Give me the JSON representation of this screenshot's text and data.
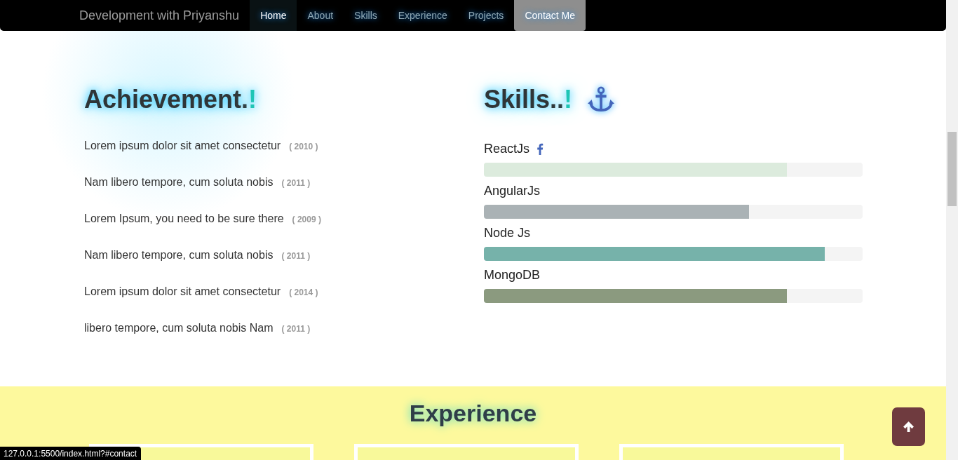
{
  "navbar": {
    "brand": "Development with Priyanshu",
    "links": [
      {
        "label": "Home",
        "selected": true,
        "highlighted": false
      },
      {
        "label": "About",
        "selected": false,
        "highlighted": false
      },
      {
        "label": "Skills",
        "selected": false,
        "highlighted": false
      },
      {
        "label": "Experience",
        "selected": false,
        "highlighted": false
      },
      {
        "label": "Projects",
        "selected": false,
        "highlighted": false
      },
      {
        "label": "Contact Me",
        "selected": false,
        "highlighted": true
      }
    ]
  },
  "achievement": {
    "title": "Achievement.",
    "title_mark": "!",
    "items": [
      {
        "text": "Lorem ipsum dolor sit amet consectetur",
        "year": "( 2010 )"
      },
      {
        "text": "Nam libero tempore, cum soluta nobis",
        "year": "( 2011 )"
      },
      {
        "text": "Lorem Ipsum, you need to be sure there",
        "year": "( 2009 )"
      },
      {
        "text": "Nam libero tempore, cum soluta nobis",
        "year": "( 2011 )"
      },
      {
        "text": "Lorem ipsum dolor sit amet consectetur",
        "year": "( 2014 )"
      },
      {
        "text": "libero tempore, cum soluta nobis Nam",
        "year": "( 2011 )"
      }
    ]
  },
  "skills": {
    "title": "Skills..",
    "title_mark": "!",
    "items": [
      {
        "name": "ReactJs",
        "icon": true,
        "level": 0.8,
        "color": "#dcebdd"
      },
      {
        "name": "AngularJs",
        "icon": false,
        "level": 0.7,
        "color": "#aab2b5"
      },
      {
        "name": "Node Js",
        "icon": false,
        "level": 0.9,
        "color": "#76b2aa"
      },
      {
        "name": "MongoDB",
        "icon": false,
        "level": 0.8,
        "color": "#8b9a7f"
      }
    ]
  },
  "experience": {
    "title": "Experience",
    "cards": [
      {
        "kind": "card"
      },
      {
        "kind": "card"
      },
      {
        "kind": "card"
      }
    ]
  },
  "status_bar": {
    "url": "127.0.0.1:5500/index.html?#contact"
  }
}
